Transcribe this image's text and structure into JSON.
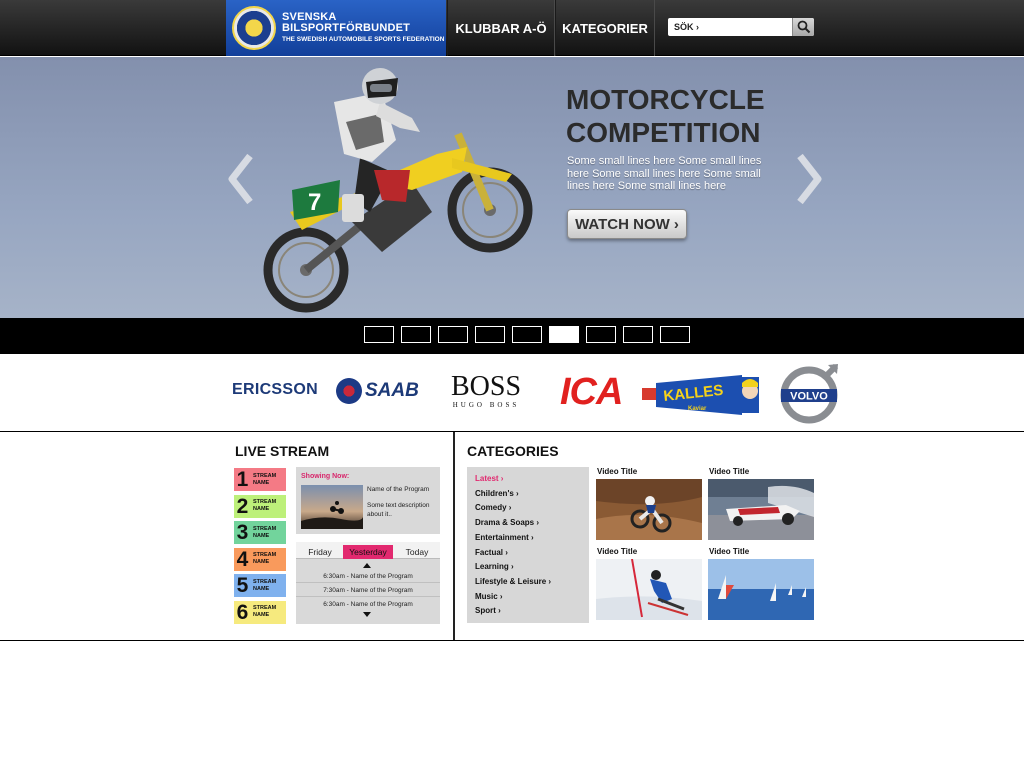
{
  "header": {
    "logo_main": "SVENSKA BILSPORTFÖRBUNDET",
    "logo_sub": "THE SWEDISH AUTOMOBILE SPORTS FEDERATION",
    "nav": [
      "KLUBBAR A-Ö",
      "KATEGORIER"
    ],
    "search_placeholder": "SÖK ›"
  },
  "hero": {
    "title": "MOTORCYCLE\nCOMPETITION",
    "description": "Some small lines here Some small lines here Some small lines here Some small lines here Some small lines here",
    "cta": "WATCH NOW ›",
    "slide_count": 9,
    "active_slide": 6,
    "bike_number": "7"
  },
  "sponsors": {
    "ericsson": "ERICSSON",
    "saab": "SAAB",
    "boss_main": "BOSS",
    "boss_sub": "HUGO BOSS",
    "ica": "ICA",
    "kalles": "KALLES",
    "kalles_sub": "Kaviar",
    "volvo": "VOLVO"
  },
  "live_stream": {
    "title": "LIVE STREAM",
    "streams": [
      {
        "number": "1",
        "label": "STREAM NAME",
        "color": "#f47a85"
      },
      {
        "number": "2",
        "label": "STREAM NAME",
        "color": "#bdf07a"
      },
      {
        "number": "3",
        "label": "STREAM NAME",
        "color": "#72d49c"
      },
      {
        "number": "4",
        "label": "STREAM NAME",
        "color": "#f99a5c"
      },
      {
        "number": "5",
        "label": "STREAM NAME",
        "color": "#7fb1ee"
      },
      {
        "number": "6",
        "label": "STREAM NAME",
        "color": "#f6ea7e"
      }
    ],
    "showing_now_label": "Showing Now:",
    "program_name": "Name of the  Program",
    "program_desc": "Some text description about it..",
    "tabs": [
      "Friday",
      "Yesterday",
      "Today"
    ],
    "active_tab": "Yesterday",
    "schedule": [
      "6:30am  - Name of the  Program",
      "7:30am  - Name of the  Program",
      "6:30am  - Name of the  Program"
    ]
  },
  "categories": {
    "title": "CATEGORIES",
    "items": [
      "Latest ›",
      "Children's ›",
      "Comedy ›",
      "Drama & Soaps ›",
      "Entertainment ›",
      "Factual ›",
      "Learning ›",
      "Lifestyle & Leisure ›",
      "Music ›",
      "Sport ›"
    ],
    "videos": [
      {
        "title": "Video Title",
        "subject": "motocross"
      },
      {
        "title": "Video Title",
        "subject": "drag-racing"
      },
      {
        "title": "Video Title",
        "subject": "skiing"
      },
      {
        "title": "Video Title",
        "subject": "sailing"
      }
    ]
  },
  "colors": {
    "accent_pink": "#e2296f",
    "header_dark": "#1a1a1a",
    "logo_blue": "#1f55b8",
    "hero_bg": "#8f9db9"
  }
}
